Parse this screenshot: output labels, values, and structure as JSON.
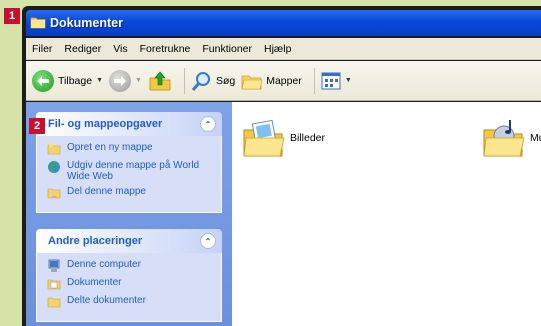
{
  "window": {
    "title": "Dokumenter"
  },
  "badges": [
    "1",
    "2"
  ],
  "menu": [
    "Filer",
    "Rediger",
    "Vis",
    "Foretrukne",
    "Funktioner",
    "Hjælp"
  ],
  "toolbar": {
    "back_label": "Tilbage",
    "search_label": "Søg",
    "folders_label": "Mapper"
  },
  "tasks": {
    "header": "Fil- og mappeopgaver",
    "items": [
      {
        "label": "Opret en ny mappe",
        "icon": "new-folder-icon"
      },
      {
        "label": "Udgiv denne mappe på World Wide Web",
        "icon": "globe-icon"
      },
      {
        "label": "Del denne mappe",
        "icon": "share-folder-icon"
      }
    ]
  },
  "places": {
    "header": "Andre placeringer",
    "items": [
      {
        "label": "Denne computer",
        "icon": "computer-icon"
      },
      {
        "label": "Dokumenter",
        "icon": "documents-icon"
      },
      {
        "label": "Delte dokumenter",
        "icon": "shared-docs-icon"
      }
    ]
  },
  "folders": [
    {
      "label": "Billeder",
      "icon": "pictures-folder-icon"
    },
    {
      "label": "Musik",
      "icon": "music-folder-icon"
    }
  ],
  "colors": {
    "titlebar": "#0a48d8",
    "link": "#215dc6",
    "badge": "#c8102e"
  }
}
